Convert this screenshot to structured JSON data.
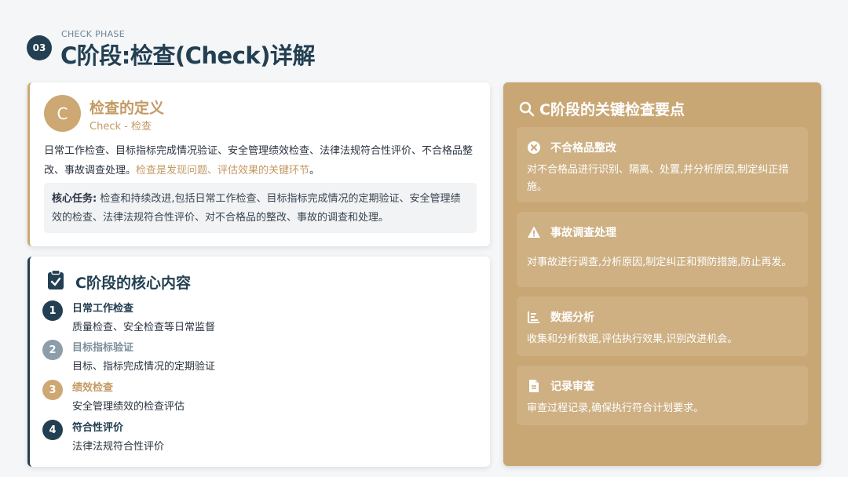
{
  "header": {
    "badge": "03",
    "subtitle": "CHECK PHASE",
    "title": "C阶段:检查(Check)详解"
  },
  "definition": {
    "letter": "C",
    "title": "检查的定义",
    "subtitle": "Check - 检查",
    "body": "日常工作检查、目标指标完成情况验证、安全管理绩效检查、法律法规符合性评价、不合格品整改、事故调查处理。",
    "highlight": "检查是发现问题、评估效果的关键环节",
    "highlight_end": "。",
    "task_label": "核心任务:",
    "task_text": " 检查和持续改进,包括日常工作检查、目标指标完成情况的定期验证、安全管理绩效的检查、法律法规符合性评价、对不合格品的整改、事故的调查和处理。"
  },
  "core": {
    "title": "C阶段的核心内容",
    "icon": "clipboard-check-icon",
    "items": [
      {
        "num": "1",
        "name": "日常工作检查",
        "desc": "质量检查、安全检查等日常监督",
        "color": "#233f52",
        "name_color": "#233f52"
      },
      {
        "num": "2",
        "name": "目标指标验证",
        "desc": "目标、指标完成情况的定期验证",
        "color": "#8c9ea9",
        "name_color": "#7d8f9a"
      },
      {
        "num": "3",
        "name": "绩效检查",
        "desc": "安全管理绩效的检查评估",
        "color": "#cda873",
        "name_color": "#c39a63"
      },
      {
        "num": "4",
        "name": "符合性评价",
        "desc": "法律法规符合性评价",
        "color": "#233f52",
        "name_color": "#233f52"
      }
    ]
  },
  "key_points": {
    "title": "C阶段的关键检查要点",
    "icon": "search-icon",
    "items": [
      {
        "icon": "close-circle-icon",
        "name": "不合格品整改",
        "desc": "对不合格品进行识别、隔离、处置,并分析原因,制定纠正措施。"
      },
      {
        "icon": "warning-icon",
        "name": "事故调查处理",
        "desc": "对事故进行调查,分析原因,制定纠正和预防措施,防止再发。"
      },
      {
        "icon": "chart-icon",
        "name": "数据分析",
        "desc": "收集和分析数据,评估执行效果,识别改进机会。"
      },
      {
        "icon": "document-icon",
        "name": "记录审查",
        "desc": "审查过程记录,确保执行符合计划要求。"
      }
    ]
  },
  "colors": {
    "navy": "#233f52",
    "gold": "#cda873",
    "panel": "#c9a775"
  }
}
